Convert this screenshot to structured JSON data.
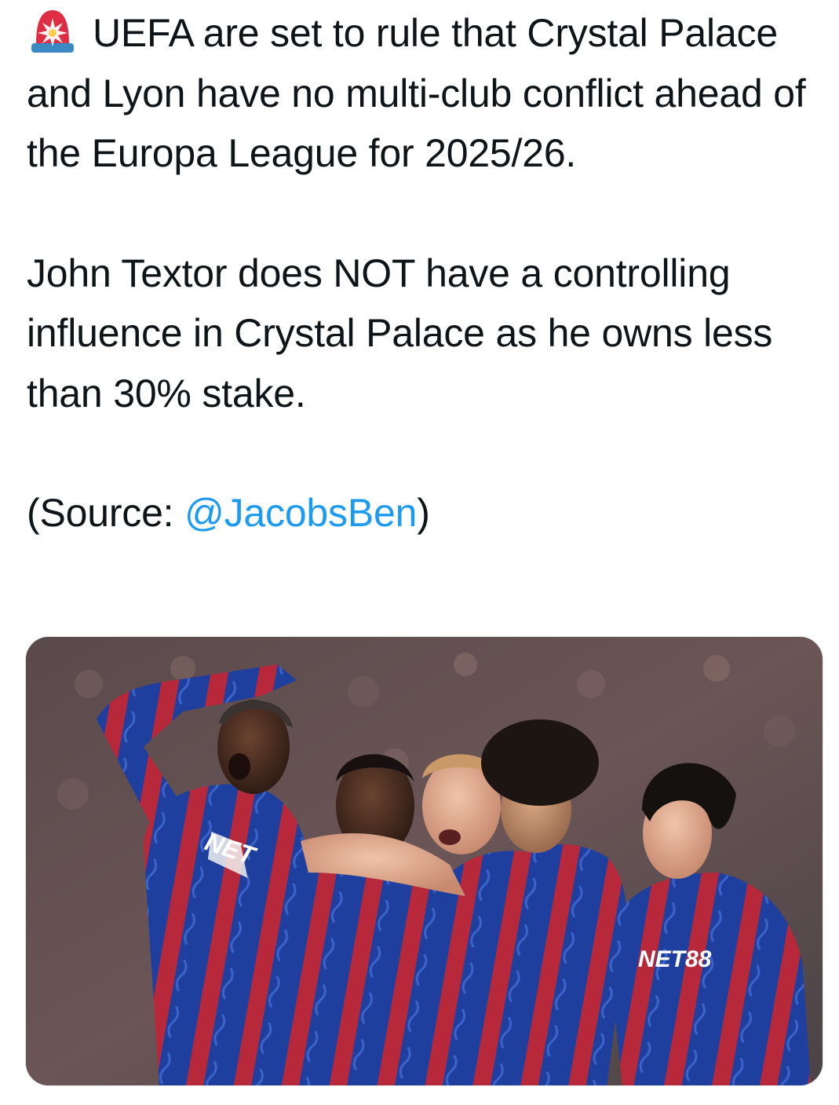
{
  "tweet": {
    "alert_icon": "police-car-light-icon",
    "line1": "UEFA are set to rule that Crystal Palace and Lyon have no multi-club conflict ahead of the Europa League for 2025/26.",
    "line2": "John Textor does NOT have a controlling influence in Crystal Palace as he owns less than 30% stake.",
    "source_prefix": "(Source: ",
    "source_handle": "@JacobsBen",
    "source_suffix": ")",
    "mention_color": "#1d9bf0"
  },
  "media": {
    "kind": "photo",
    "subject": "Crystal Palace players celebrating",
    "shirt_sponsor_a": "NET",
    "shirt_sponsor_b": "NET88",
    "kit_colors": [
      "#1b3fa8",
      "#c0283a"
    ]
  }
}
